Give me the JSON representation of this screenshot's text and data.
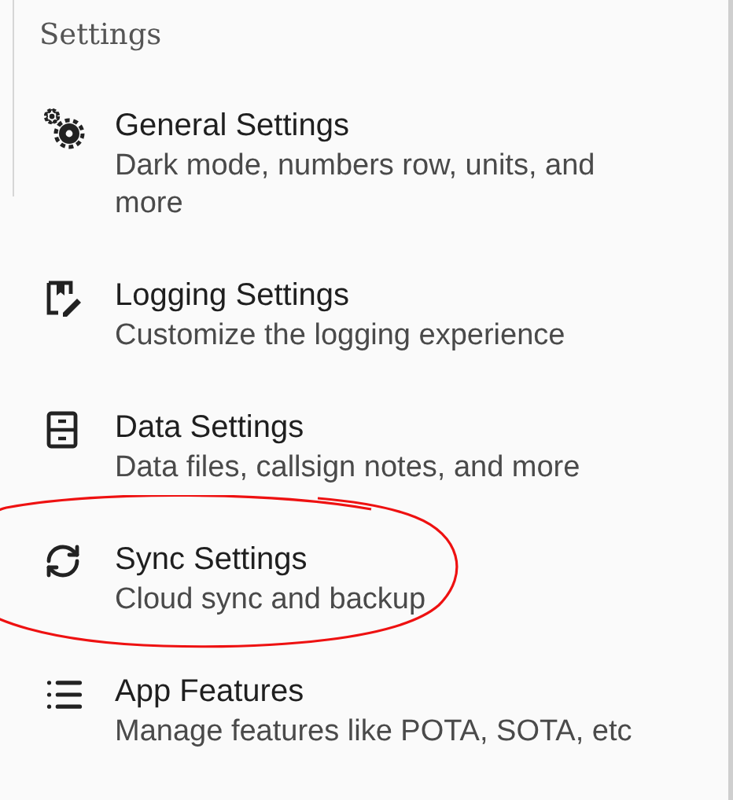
{
  "header": {
    "title": "Settings"
  },
  "items": [
    {
      "title": "General Settings",
      "subtitle": "Dark mode, numbers row, units, and more",
      "circled": false
    },
    {
      "title": "Logging Settings",
      "subtitle": "Customize the logging experience",
      "circled": false
    },
    {
      "title": "Data Settings",
      "subtitle": "Data files, callsign notes, and more",
      "circled": false
    },
    {
      "title": "Sync Settings",
      "subtitle": "Cloud sync and backup",
      "circled": true
    },
    {
      "title": "App Features",
      "subtitle": "Manage features like POTA, SOTA, etc",
      "circled": false
    }
  ]
}
